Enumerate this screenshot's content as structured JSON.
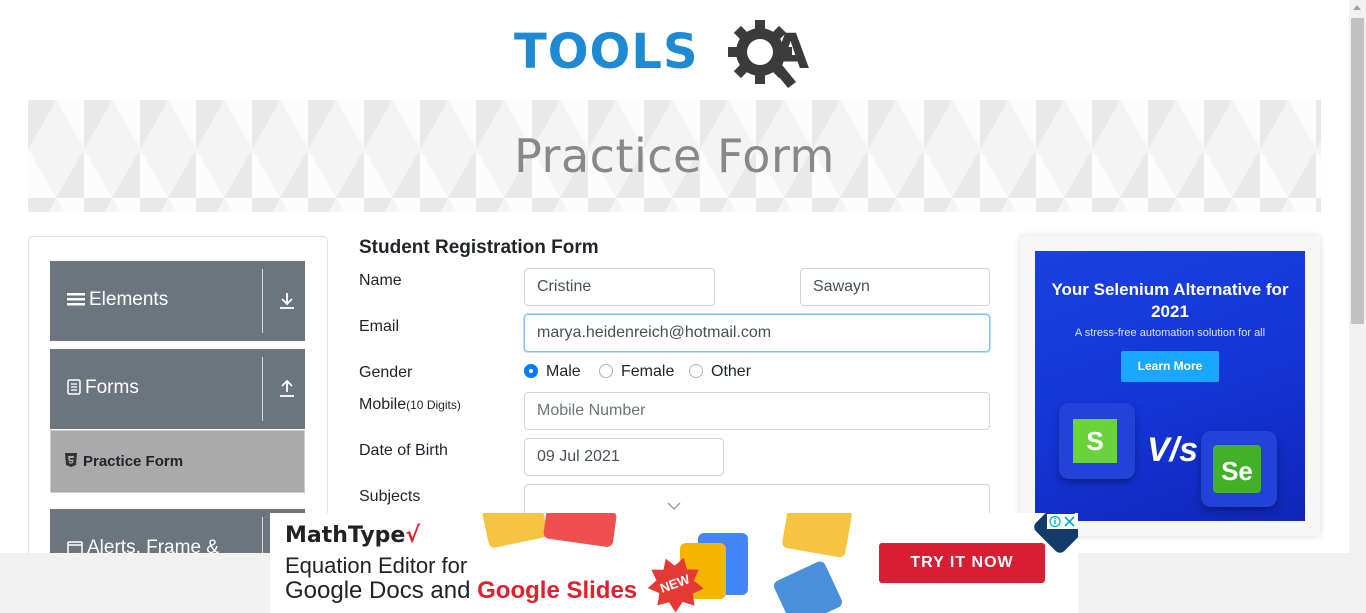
{
  "brand": {
    "logo_text_tools": "TOOLS",
    "logo_text_a": "A"
  },
  "banner": {
    "title": "Practice Form"
  },
  "sidebar": {
    "groups": [
      {
        "label": "Elements",
        "icon": "list-icon",
        "arrow": "download-arrow-icon"
      },
      {
        "label": "Forms",
        "icon": "document-icon",
        "arrow": "upload-arrow-icon"
      },
      {
        "label": "Alerts, Frame &",
        "icon": "window-icon"
      }
    ],
    "active_item": {
      "label": "Practice Form",
      "icon": "html5-icon"
    }
  },
  "form": {
    "title": "Student Registration Form",
    "labels": {
      "name": "Name",
      "email": "Email",
      "gender": "Gender",
      "mobile": "Mobile",
      "mobile_hint": "(10 Digits)",
      "dob": "Date of Birth",
      "subjects": "Subjects"
    },
    "first_name": "Cristine",
    "last_name": "Sawayn",
    "email": "marya.heidenreich@hotmail.com",
    "gender_options": [
      "Male",
      "Female",
      "Other"
    ],
    "gender_selected": "Male",
    "mobile_placeholder": "Mobile Number",
    "dob": "09 Jul 2021"
  },
  "ad_right": {
    "headline": "Your Selenium Alternative for 2021",
    "sub": "A stress-free automation solution for all",
    "button": "Learn More",
    "logo_left": "S",
    "vs": "V/s",
    "logo_right": "Se"
  },
  "ad_bottom": {
    "brand": "MathType",
    "line1": "Equation Editor for",
    "line2_plain": "Google Docs and ",
    "line2_highlight": "Google Slides",
    "badge": "NEW",
    "cta": "TRY IT NOW"
  },
  "colors": {
    "accent": "#1e8ad3",
    "sidebar": "#6c757d",
    "active_item": "#aaaaaa",
    "radio_on": "#007bff",
    "cta": "#d81e32"
  }
}
